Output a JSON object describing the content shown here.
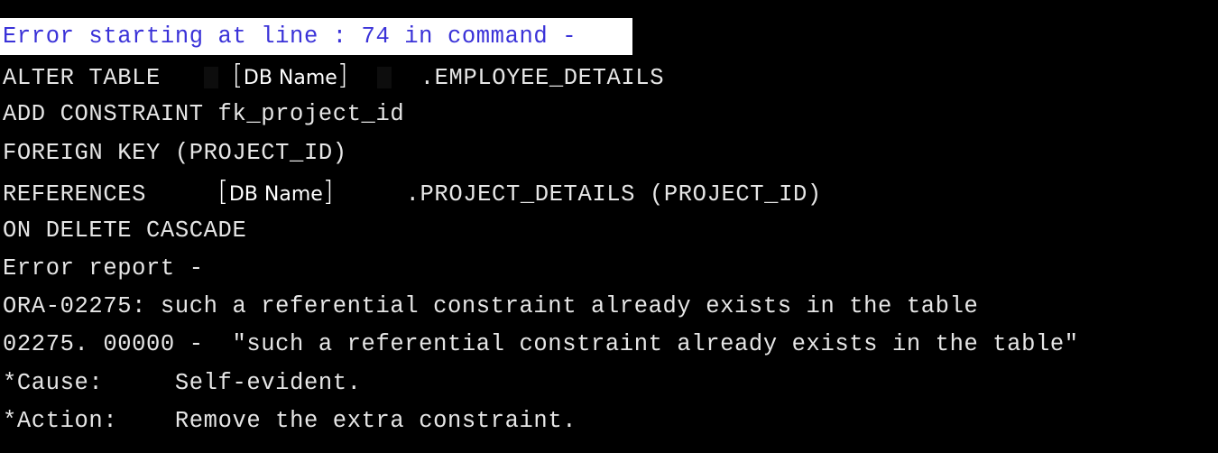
{
  "error_header": "Error starting at line : 74 in command -",
  "sql": {
    "alter_prefix": "ALTER TABLE",
    "alter_db_name": "DB Name",
    "alter_suffix": ".EMPLOYEE_DETAILS",
    "add_constraint": "ADD CONSTRAINT fk_project_id",
    "foreign_key": "FOREIGN KEY (PROJECT_ID)",
    "references_prefix": "REFERENCES",
    "references_db_name": "DB Name",
    "references_suffix": ".PROJECT_DETAILS (PROJECT_ID)",
    "on_delete": "ON DELETE CASCADE"
  },
  "report": {
    "heading": "Error report -",
    "ora_line": "ORA-02275: such a referential constraint already exists in the table",
    "code_line": "02275. 00000 -  \"such a referential constraint already exists in the table\"",
    "cause_label": "*Cause:",
    "cause_text": "Self-evident.",
    "action_label": "*Action:",
    "action_text": "Remove the extra constraint."
  },
  "colors": {
    "background": "#000000",
    "text": "#e6e6e6",
    "header_bg": "#ffffff",
    "header_text": "#3a32d8"
  }
}
